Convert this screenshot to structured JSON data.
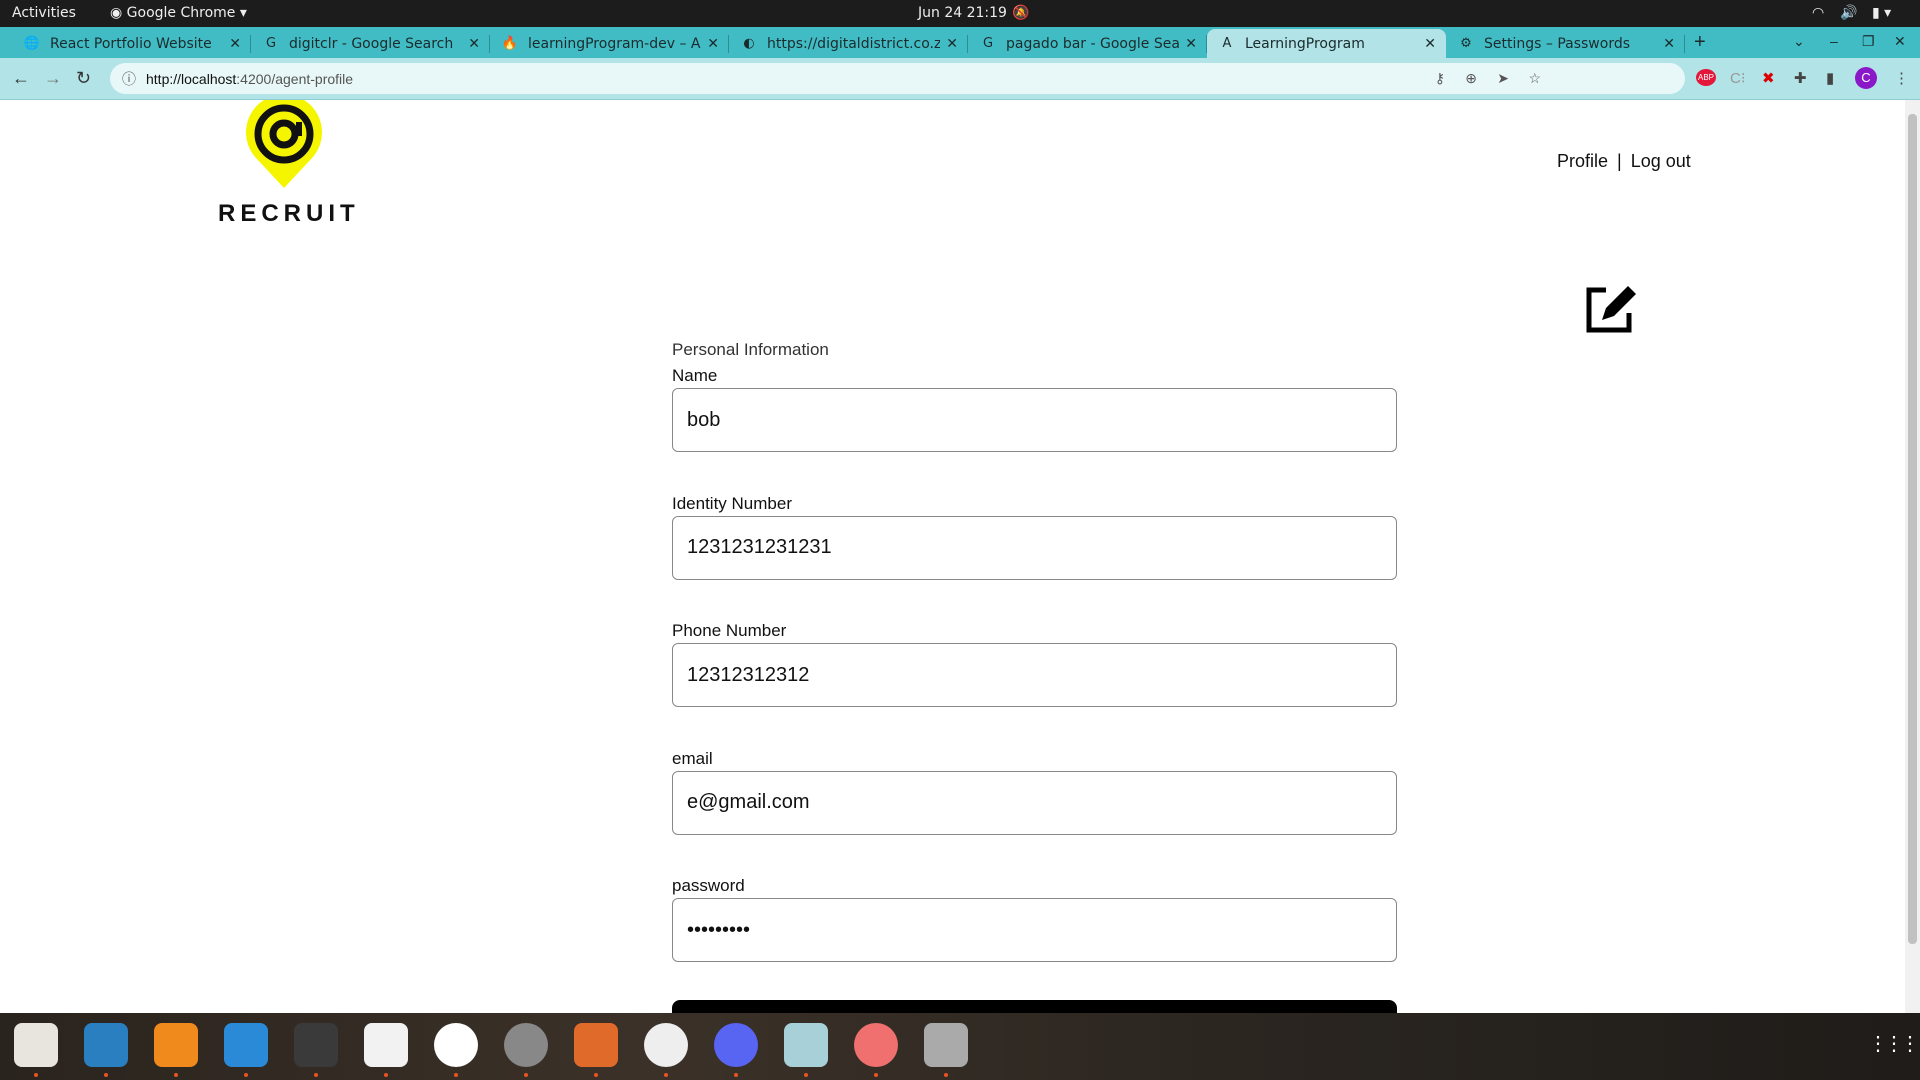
{
  "system": {
    "activities": "Activities",
    "app": "Google Chrome",
    "datetime": "Jun 24  21:19"
  },
  "tabs": [
    {
      "title": "React Portfolio Website",
      "icon": "globe-icon",
      "active": false
    },
    {
      "title": "digitclr - Google Search",
      "icon": "google-icon",
      "active": false
    },
    {
      "title": "learningProgram-dev – Au",
      "icon": "firebase-icon",
      "active": false
    },
    {
      "title": "https://digitaldistrict.co.za",
      "icon": "site-icon",
      "active": false
    },
    {
      "title": "pagado bar - Google Search",
      "icon": "google-icon",
      "active": false
    },
    {
      "title": "LearningProgram",
      "icon": "angular-icon",
      "active": true
    },
    {
      "title": "Settings – Passwords",
      "icon": "gear-icon",
      "active": false
    }
  ],
  "browser": {
    "url_host": "http://localhost",
    "url_path": ":4200/agent-profile",
    "profile_initial": "C",
    "abp": "ABP"
  },
  "header": {
    "logo_text": "RECRUIT",
    "profile": "Profile",
    "separator": "|",
    "logout": "Log out"
  },
  "form": {
    "section": "Personal Information",
    "fields": [
      {
        "label": "Name",
        "value": "bob",
        "type": "text"
      },
      {
        "label": "Identity Number",
        "value": "1231231231231",
        "type": "text"
      },
      {
        "label": "Phone Number",
        "value": "12312312312",
        "type": "text"
      },
      {
        "label": "email",
        "value": "e@gmail.com",
        "type": "text"
      },
      {
        "label": "password",
        "value": "secret123",
        "type": "password"
      }
    ]
  },
  "colors": {
    "accent": "#42bcc4",
    "logo_yellow": "#f5f500"
  },
  "dock": [
    "files",
    "writer",
    "vlc",
    "vscode",
    "terminal",
    "text-editor",
    "slack",
    "settings",
    "impress",
    "chrome",
    "discord",
    "virtualbox",
    "disk-usage",
    "usb"
  ]
}
